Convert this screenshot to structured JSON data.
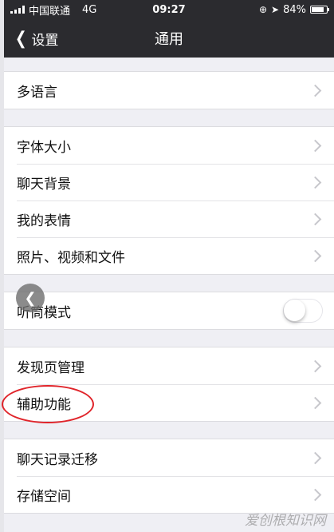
{
  "status_bar": {
    "carrier": "中国联通",
    "network": "4G",
    "time": "09:27",
    "battery": "84%",
    "battery_level": 0.84
  },
  "nav": {
    "back_label": "设置",
    "title": "通用"
  },
  "groups": [
    {
      "items": [
        {
          "label": "多语言"
        }
      ]
    },
    {
      "items": [
        {
          "label": "字体大小"
        },
        {
          "label": "聊天背景"
        },
        {
          "label": "我的表情"
        },
        {
          "label": "照片、视频和文件"
        }
      ]
    },
    {
      "items": [
        {
          "label": "听筒模式",
          "toggle": false
        }
      ]
    },
    {
      "items": [
        {
          "label": "发现页管理"
        },
        {
          "label": "辅助功能"
        }
      ]
    },
    {
      "items": [
        {
          "label": "聊天记录迁移"
        },
        {
          "label": "存储空间"
        }
      ]
    }
  ],
  "watermark": "爱创根知识网",
  "colors": {
    "header": "#2b2b2f",
    "background": "#efeff4",
    "annotation": "#e0242a"
  }
}
